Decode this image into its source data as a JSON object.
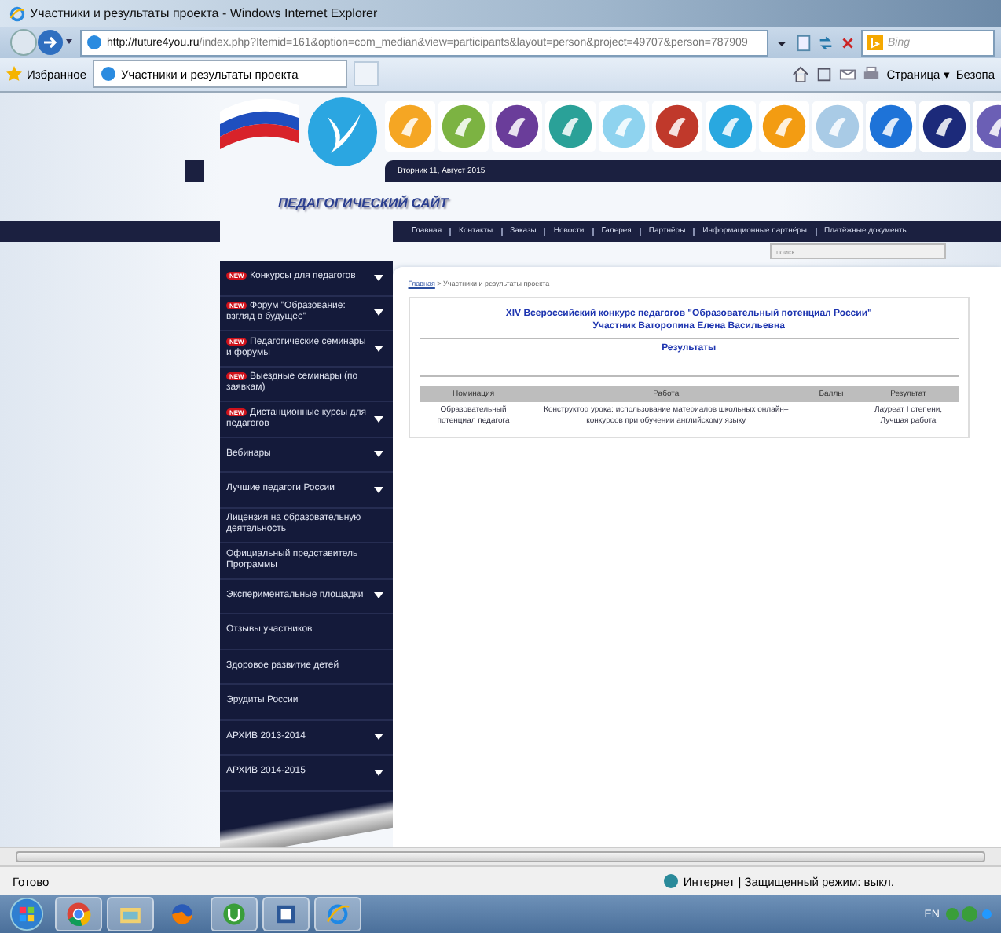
{
  "window": {
    "title": "Участники и результаты проекта - Windows Internet Explorer"
  },
  "address_bar": {
    "url_host": "http://future4you.ru",
    "url_path": "/index.php?Itemid=161&option=com_median&view=participants&layout=person&project=49707&person=787909",
    "search_placeholder": "Bing"
  },
  "favorites_bar": {
    "favorites_label": "Избранное",
    "tab_title": "Участники и результаты проекта",
    "page_menu": "Страница ▾",
    "safety_menu": "Безопа"
  },
  "site": {
    "date": "Вторник 11, Август 2015",
    "title": "ПЕДАГОГИЧЕСКИЙ САЙТ",
    "project_icons": [
      {
        "color": "#f5a623"
      },
      {
        "color": "#7cb342"
      },
      {
        "color": "#6a3d9a"
      },
      {
        "color": "#2aa198"
      },
      {
        "color": "#8fd3ef"
      },
      {
        "color": "#c0392b"
      },
      {
        "color": "#29a8e0"
      },
      {
        "color": "#f39c12"
      },
      {
        "color": "#a9cbe6"
      },
      {
        "color": "#1e73d8"
      },
      {
        "color": "#1c2a7a"
      },
      {
        "color": "#6b5fb5"
      }
    ],
    "nav": [
      "Главная",
      "Контакты",
      "Заказы",
      "Новости",
      "Галерея",
      "Партнёры",
      "Информационные партнёры",
      "Платёжные документы"
    ],
    "search_placeholder": "поиск...",
    "sidebar": [
      {
        "label": "Конкурсы для педагогов",
        "badge": "NEW",
        "has_submenu": true
      },
      {
        "label": "Форум \"Образование: взгляд в будущее\"",
        "badge": "NEW",
        "has_submenu": true
      },
      {
        "label": "Педагогические семинары и форумы",
        "badge": "NEW",
        "has_submenu": true
      },
      {
        "label": "Выездные семинары (по заявкам)",
        "badge": "NEW",
        "has_submenu": false
      },
      {
        "label": "Дистанционные курсы для педагогов",
        "badge": "NEW",
        "has_submenu": true
      },
      {
        "label": "Вебинары",
        "has_submenu": true
      },
      {
        "label": "Лучшие педагоги России",
        "has_submenu": true
      },
      {
        "label": "Лицензия на образовательную деятельность",
        "has_submenu": false
      },
      {
        "label": "Официальный представитель Программы",
        "has_submenu": false
      },
      {
        "label": "Экспериментальные площадки",
        "has_submenu": true
      },
      {
        "label": "Отзывы участников",
        "has_submenu": false
      },
      {
        "label": "Здоровое развитие детей",
        "has_submenu": false
      },
      {
        "label": "Эрудиты России",
        "has_submenu": false
      },
      {
        "label": "АРХИВ 2013-2014",
        "has_submenu": true
      },
      {
        "label": "АРХИВ 2014-2015",
        "has_submenu": true
      }
    ],
    "breadcrumb": {
      "home": "Главная",
      "current": "> Участники и результаты проекта"
    },
    "contest_title": "XIV Всероссийский конкурс педагогов \"Образовательный потенциал России\"",
    "participant": "Участник Ваторопина Елена Васильевна",
    "results_heading": "Результаты",
    "table": {
      "columns": [
        "Номинация",
        "Работа",
        "Баллы",
        "Результат"
      ],
      "rows": [
        {
          "nomination": "Образовательный потенциал педагога",
          "work": "Конструктор урока: использование материалов школьных онлайн–конкурсов при обучении английскому языку",
          "result": "Лауреат I степени, Лучшая работа"
        }
      ]
    }
  },
  "status_bar": {
    "status": "Готово",
    "zone": "Интернет | Защищенный режим: выкл."
  },
  "taskbar": {
    "apps": [
      {
        "kind": "chrome",
        "running": true
      },
      {
        "kind": "folder",
        "running": true
      },
      {
        "kind": "firefox",
        "running": false
      },
      {
        "kind": "utorrent",
        "running": true
      },
      {
        "kind": "word",
        "running": true
      },
      {
        "kind": "ie",
        "running": true
      }
    ],
    "language": "EN"
  }
}
